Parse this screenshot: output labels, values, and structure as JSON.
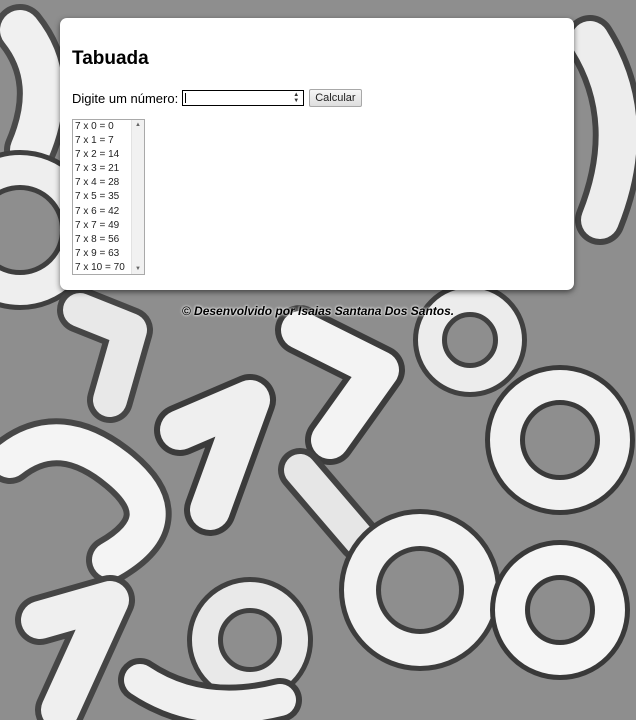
{
  "page": {
    "title": "Tabuada"
  },
  "form": {
    "label": "Digite um número:",
    "input_value": "",
    "button_label": "Calcular"
  },
  "results": [
    "7 x 0 = 0",
    "7 x 1 = 7",
    "7 x 2 = 14",
    "7 x 3 = 21",
    "7 x 4 = 28",
    "7 x 5 = 35",
    "7 x 6 = 42",
    "7 x 7 = 49",
    "7 x 8 = 56",
    "7 x 9 = 63",
    "7 x 10 = 70"
  ],
  "footer": {
    "text": "© Desenvolvido por Isaias Santana Dos Santos."
  },
  "colors": {
    "card": "#ffffff",
    "text": "#000000",
    "background": "#9a9a9a"
  },
  "icons": {
    "spinner": "up-down-arrows-icon",
    "scroll": "scroll-arrow-icon"
  }
}
